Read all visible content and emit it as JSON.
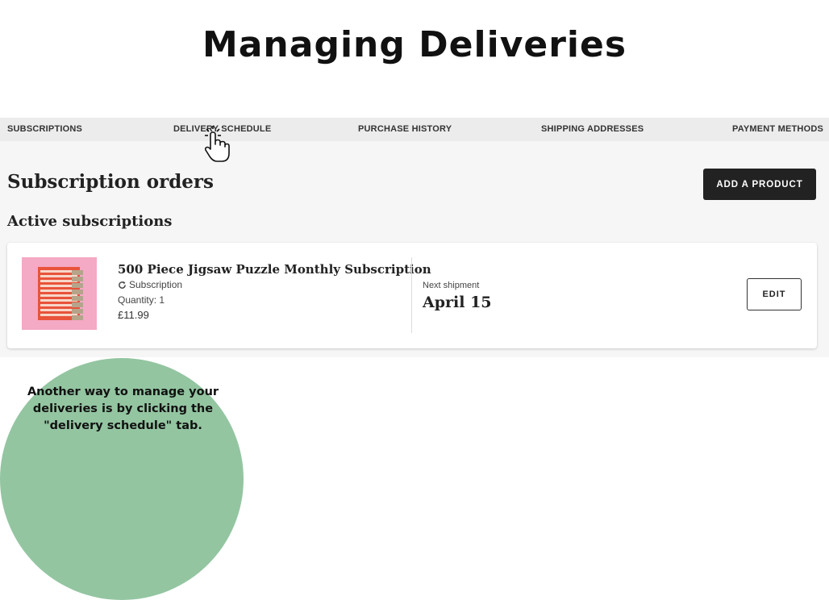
{
  "slide": {
    "title": "Managing Deliveries",
    "callout": "Another way to manage your deliveries is by clicking the \"delivery schedule\" tab."
  },
  "tabs": [
    {
      "label": "SUBSCRIPTIONS"
    },
    {
      "label": "DELIVERY SCHEDULE"
    },
    {
      "label": "PURCHASE HISTORY"
    },
    {
      "label": "SHIPPING ADDRESSES"
    },
    {
      "label": "PAYMENT METHODS"
    }
  ],
  "main": {
    "heading": "Subscription orders",
    "subheading": "Active subscriptions",
    "add_button": "ADD A PRODUCT"
  },
  "subscription": {
    "name": "500 Piece Jigsaw Puzzle Monthly Subscription",
    "type": "Subscription",
    "quantity": "Quantity: 1",
    "price": "£11.99",
    "next_label": "Next shipment",
    "next_date": "April 15",
    "edit_button": "EDIT"
  },
  "icons": {
    "refresh": "refresh-icon",
    "cursor": "hand-pointer-icon"
  },
  "colors": {
    "button_dark": "#222222",
    "callout": "#93c5a1",
    "product_pink": "#f4a9c4",
    "product_box": "#e8533a"
  }
}
